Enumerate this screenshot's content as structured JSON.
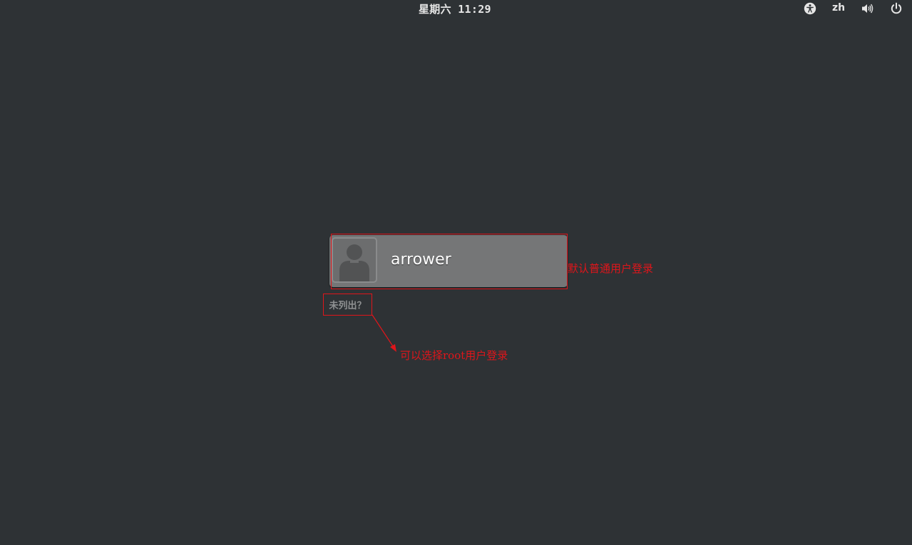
{
  "topbar": {
    "clock": "星期六 11:29",
    "language": "zh",
    "icons": {
      "accessibility": "accessibility-icon",
      "volume": "volume-icon",
      "power": "power-icon"
    }
  },
  "login": {
    "username": "arrower",
    "avatar_icon": "user-avatar-icon",
    "not_listed_label": "未列出？"
  },
  "annotations": {
    "user_note": "默认普通用户登录",
    "root_note": "可以选择root用户登录",
    "color": "#e0151a"
  }
}
